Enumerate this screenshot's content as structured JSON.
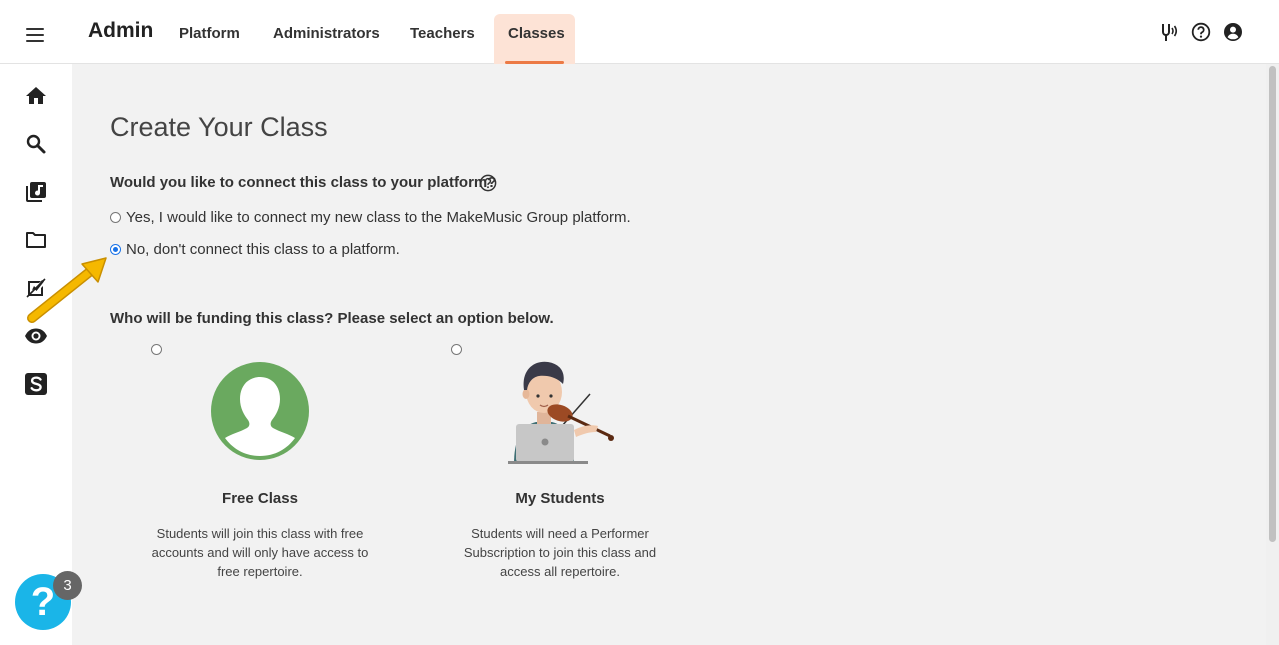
{
  "header": {
    "app_title": "Admin",
    "tabs": [
      {
        "label": "Platform",
        "active": false
      },
      {
        "label": "Administrators",
        "active": false
      },
      {
        "label": "Teachers",
        "active": false
      },
      {
        "label": "Classes",
        "active": true
      }
    ],
    "right_icons": [
      "tuning-fork-icon",
      "help-circle-icon",
      "account-circle-icon"
    ]
  },
  "sidebar": {
    "icons": [
      "home-icon",
      "search-icon",
      "music-library-icon",
      "folder-icon",
      "assignment-icon",
      "eye-icon",
      "s-logo-icon"
    ]
  },
  "main": {
    "title": "Create Your Class",
    "platform_question": "Would you like to connect this class to your platform?",
    "platform_options": [
      {
        "label": "Yes, I would like to connect my new class to the MakeMusic Group platform.",
        "checked": false
      },
      {
        "label": "No, don't connect this class to a platform.",
        "checked": true
      }
    ],
    "funding_question": "Who will be funding this class? Please select an option below.",
    "funding_options": [
      {
        "title": "Free Class",
        "description": "Students will join this class with free accounts and will only have access to free repertoire.",
        "checked": false
      },
      {
        "title": "My Students",
        "description": "Students will need a Performer Subscription to join this class and access all repertoire.",
        "checked": false
      }
    ]
  },
  "help_fab": {
    "label": "?",
    "badge": "3"
  },
  "colors": {
    "accent": "#ec7a45",
    "active_tab_bg": "#fde3d6",
    "content_bg": "#f2f2f2",
    "avatar_green": "#6aa95f",
    "help_blue": "#1ab5e8",
    "arrow_yellow": "#f5b800",
    "radio_blue": "#1a73e8"
  }
}
